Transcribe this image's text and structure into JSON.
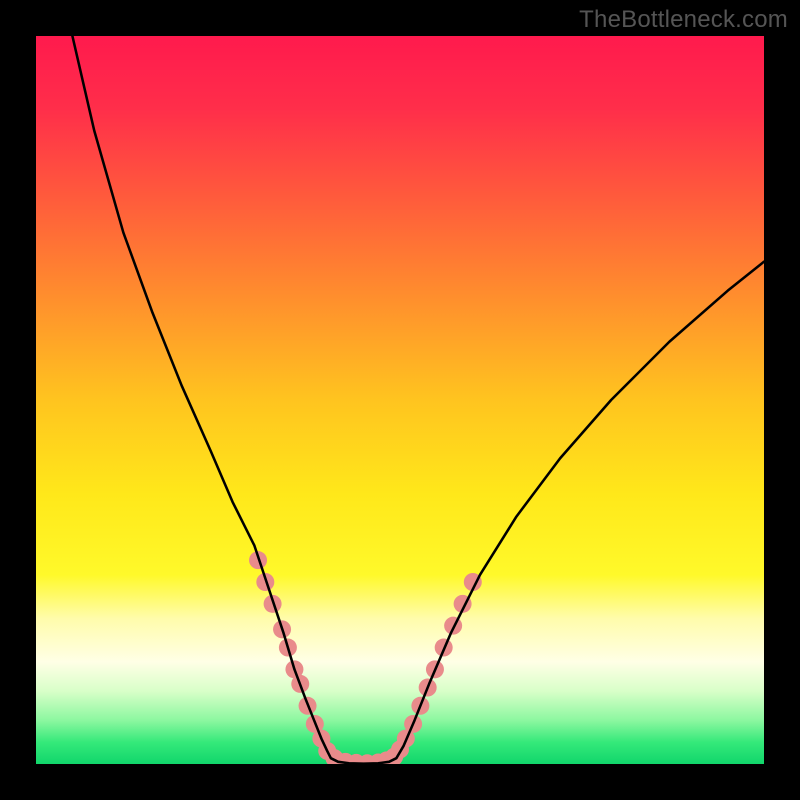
{
  "watermark": "TheBottleneck.com",
  "colors": {
    "gradient_stops": [
      {
        "offset": 0.0,
        "color": "#ff1a4d"
      },
      {
        "offset": 0.1,
        "color": "#ff2e4a"
      },
      {
        "offset": 0.22,
        "color": "#ff5a3c"
      },
      {
        "offset": 0.35,
        "color": "#ff8b2e"
      },
      {
        "offset": 0.5,
        "color": "#ffc41f"
      },
      {
        "offset": 0.63,
        "color": "#ffe81a"
      },
      {
        "offset": 0.74,
        "color": "#fff92a"
      },
      {
        "offset": 0.8,
        "color": "#fffcab"
      },
      {
        "offset": 0.86,
        "color": "#ffffe6"
      },
      {
        "offset": 0.9,
        "color": "#d8ffc8"
      },
      {
        "offset": 0.94,
        "color": "#8cf7a0"
      },
      {
        "offset": 0.97,
        "color": "#35e97a"
      },
      {
        "offset": 1.0,
        "color": "#11d66b"
      }
    ],
    "curve_stroke": "#000000",
    "marker_fill": "#e98b8b",
    "marker_stroke": "#e98b8b"
  },
  "chart_data": {
    "type": "line",
    "title": "",
    "xlabel": "",
    "ylabel": "",
    "xlim": [
      0,
      100
    ],
    "ylim": [
      0,
      100
    ],
    "grid": false,
    "series": [
      {
        "name": "left-arm",
        "x": [
          5,
          8,
          12,
          16,
          20,
          24,
          27,
          30,
          32,
          34,
          35.5,
          37,
          38.2,
          39.2,
          40,
          40.5
        ],
        "y": [
          100,
          87,
          73,
          62,
          52,
          43,
          36,
          30,
          24,
          18,
          13,
          9,
          6,
          3.5,
          1.8,
          0.8
        ]
      },
      {
        "name": "valley-floor",
        "x": [
          40.5,
          41.5,
          43,
          45,
          47,
          48.5,
          49.5
        ],
        "y": [
          0.8,
          0.3,
          0.1,
          0.05,
          0.1,
          0.3,
          0.8
        ]
      },
      {
        "name": "right-arm",
        "x": [
          49.5,
          50.5,
          52,
          54,
          57,
          61,
          66,
          72,
          79,
          87,
          95,
          100
        ],
        "y": [
          0.8,
          2.5,
          6,
          11,
          18,
          26,
          34,
          42,
          50,
          58,
          65,
          69
        ]
      }
    ],
    "markers": [
      {
        "x": 30.5,
        "y": 28.0
      },
      {
        "x": 31.5,
        "y": 25.0
      },
      {
        "x": 32.5,
        "y": 22.0
      },
      {
        "x": 33.8,
        "y": 18.5
      },
      {
        "x": 34.6,
        "y": 16.0
      },
      {
        "x": 35.5,
        "y": 13.0
      },
      {
        "x": 36.3,
        "y": 11.0
      },
      {
        "x": 37.3,
        "y": 8.0
      },
      {
        "x": 38.3,
        "y": 5.5
      },
      {
        "x": 39.2,
        "y": 3.5
      },
      {
        "x": 40.0,
        "y": 1.8
      },
      {
        "x": 41.0,
        "y": 0.8
      },
      {
        "x": 42.5,
        "y": 0.3
      },
      {
        "x": 44.0,
        "y": 0.15
      },
      {
        "x": 45.5,
        "y": 0.1
      },
      {
        "x": 47.0,
        "y": 0.2
      },
      {
        "x": 48.2,
        "y": 0.5
      },
      {
        "x": 49.2,
        "y": 1.0
      },
      {
        "x": 50.0,
        "y": 2.0
      },
      {
        "x": 50.8,
        "y": 3.5
      },
      {
        "x": 51.8,
        "y": 5.5
      },
      {
        "x": 52.8,
        "y": 8.0
      },
      {
        "x": 53.8,
        "y": 10.5
      },
      {
        "x": 54.8,
        "y": 13.0
      },
      {
        "x": 56.0,
        "y": 16.0
      },
      {
        "x": 57.3,
        "y": 19.0
      },
      {
        "x": 58.6,
        "y": 22.0
      },
      {
        "x": 60.0,
        "y": 25.0
      }
    ],
    "marker_radius_px": 9
  }
}
